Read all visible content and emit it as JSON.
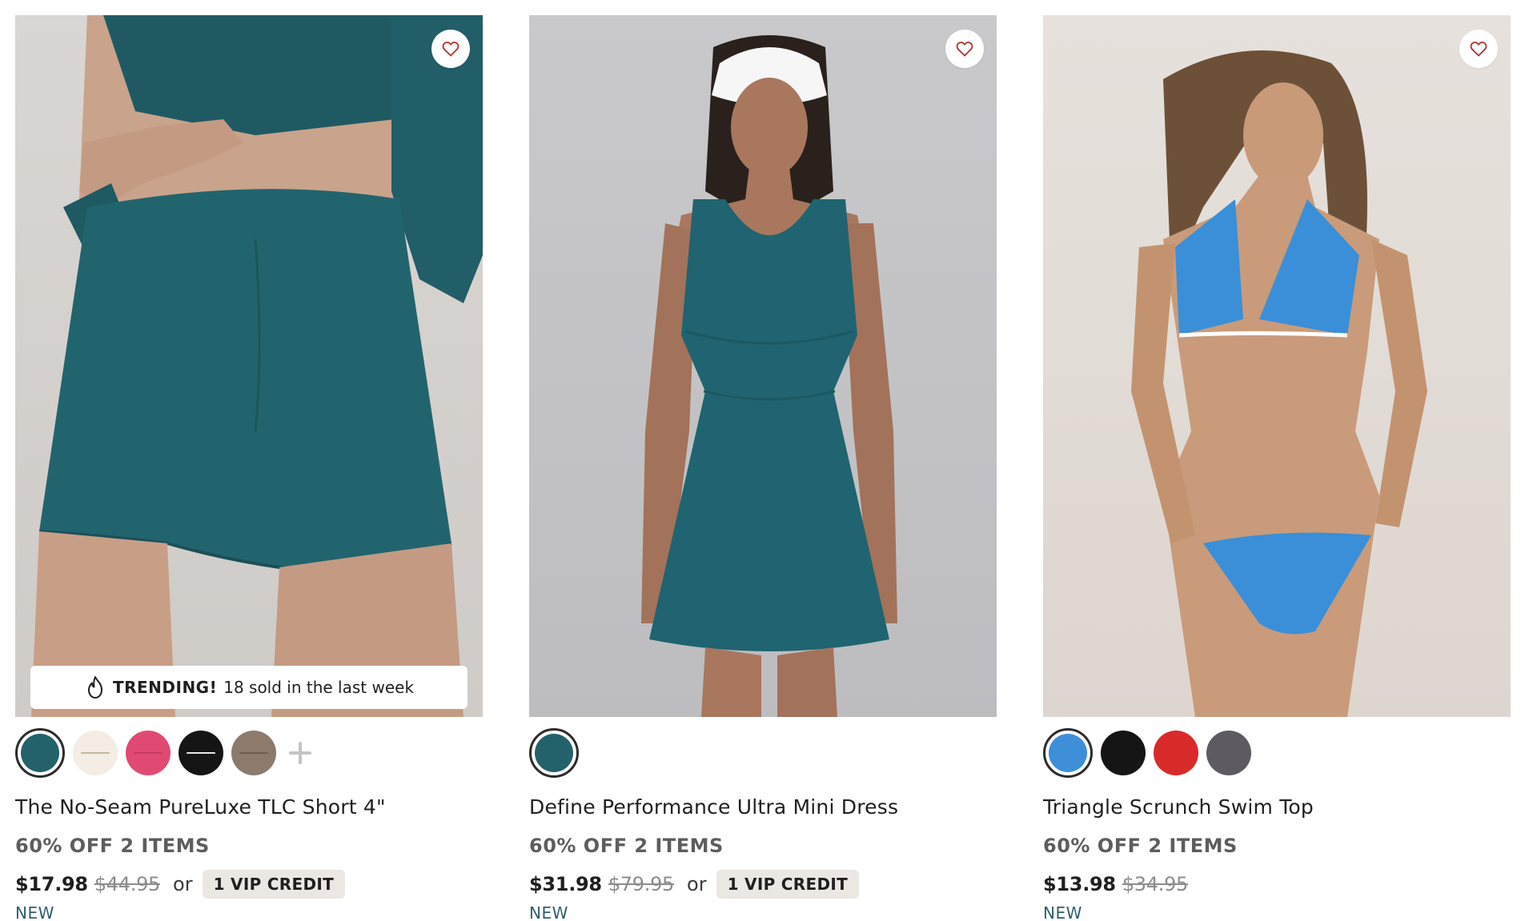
{
  "products": [
    {
      "name": "The No-Seam PureLuxe TLC Short 4\"",
      "promo": "60% OFF 2 ITEMS",
      "price": "$17.98",
      "original_price": "$44.95",
      "or_label": "or",
      "vip_label": "1 VIP CREDIT",
      "tag": "NEW",
      "trending": {
        "label": "TRENDING!",
        "text": "18 sold in the last week"
      },
      "swatches": [
        "#23616b",
        "#f3ede3",
        "#e04a72",
        "#151515",
        "#8c7a6d"
      ],
      "selected_swatch": 0,
      "more_icon": "plus-icon"
    },
    {
      "name": "Define Performance Ultra Mini Dress",
      "promo": "60% OFF 2 ITEMS",
      "price": "$31.98",
      "original_price": "$79.95",
      "or_label": "or",
      "vip_label": "1 VIP CREDIT",
      "tag": "NEW",
      "swatches": [
        "#23616b"
      ],
      "selected_swatch": 0
    },
    {
      "name": "Triangle Scrunch Swim Top",
      "promo": "60% OFF 2 ITEMS",
      "price": "$13.98",
      "original_price": "$34.95",
      "tag": "NEW",
      "swatches": [
        "#3d8fd8",
        "#151515",
        "#d92a2a",
        "#5d5a62"
      ],
      "selected_swatch": 0
    }
  ],
  "icons": {
    "favorite": "heart-outline-icon",
    "trending": "flame-icon"
  },
  "colors": {
    "teal": "#23616b",
    "heart": "#b3312f",
    "new_tag": "#2d5f6b",
    "vip_badge_bg": "#ebe7e2"
  }
}
